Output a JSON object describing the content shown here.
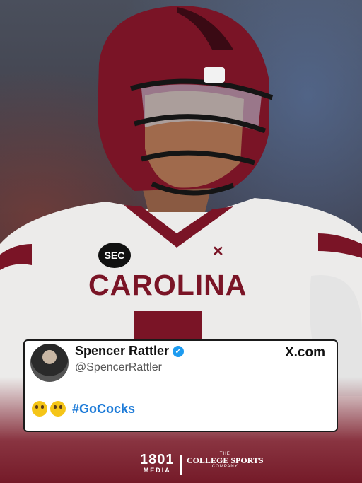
{
  "tweet": {
    "display_name": "Spencer Rattler",
    "handle": "@SpencerRattler",
    "source": "X.com",
    "hashtag": "#GoCocks",
    "emoji_count": 2
  },
  "jersey": {
    "team_text": "CAROLINA",
    "conference_badge": "SEC"
  },
  "footer": {
    "brand_number": "1801",
    "brand_sub": "MEDIA",
    "partner_the": "THE",
    "partner_name": "COLLEGE SPORTS",
    "partner_company": "COMPANY"
  },
  "colors": {
    "garnet": "#7a1426",
    "link_blue": "#1d7bd8",
    "verified_blue": "#1d9bf0"
  }
}
